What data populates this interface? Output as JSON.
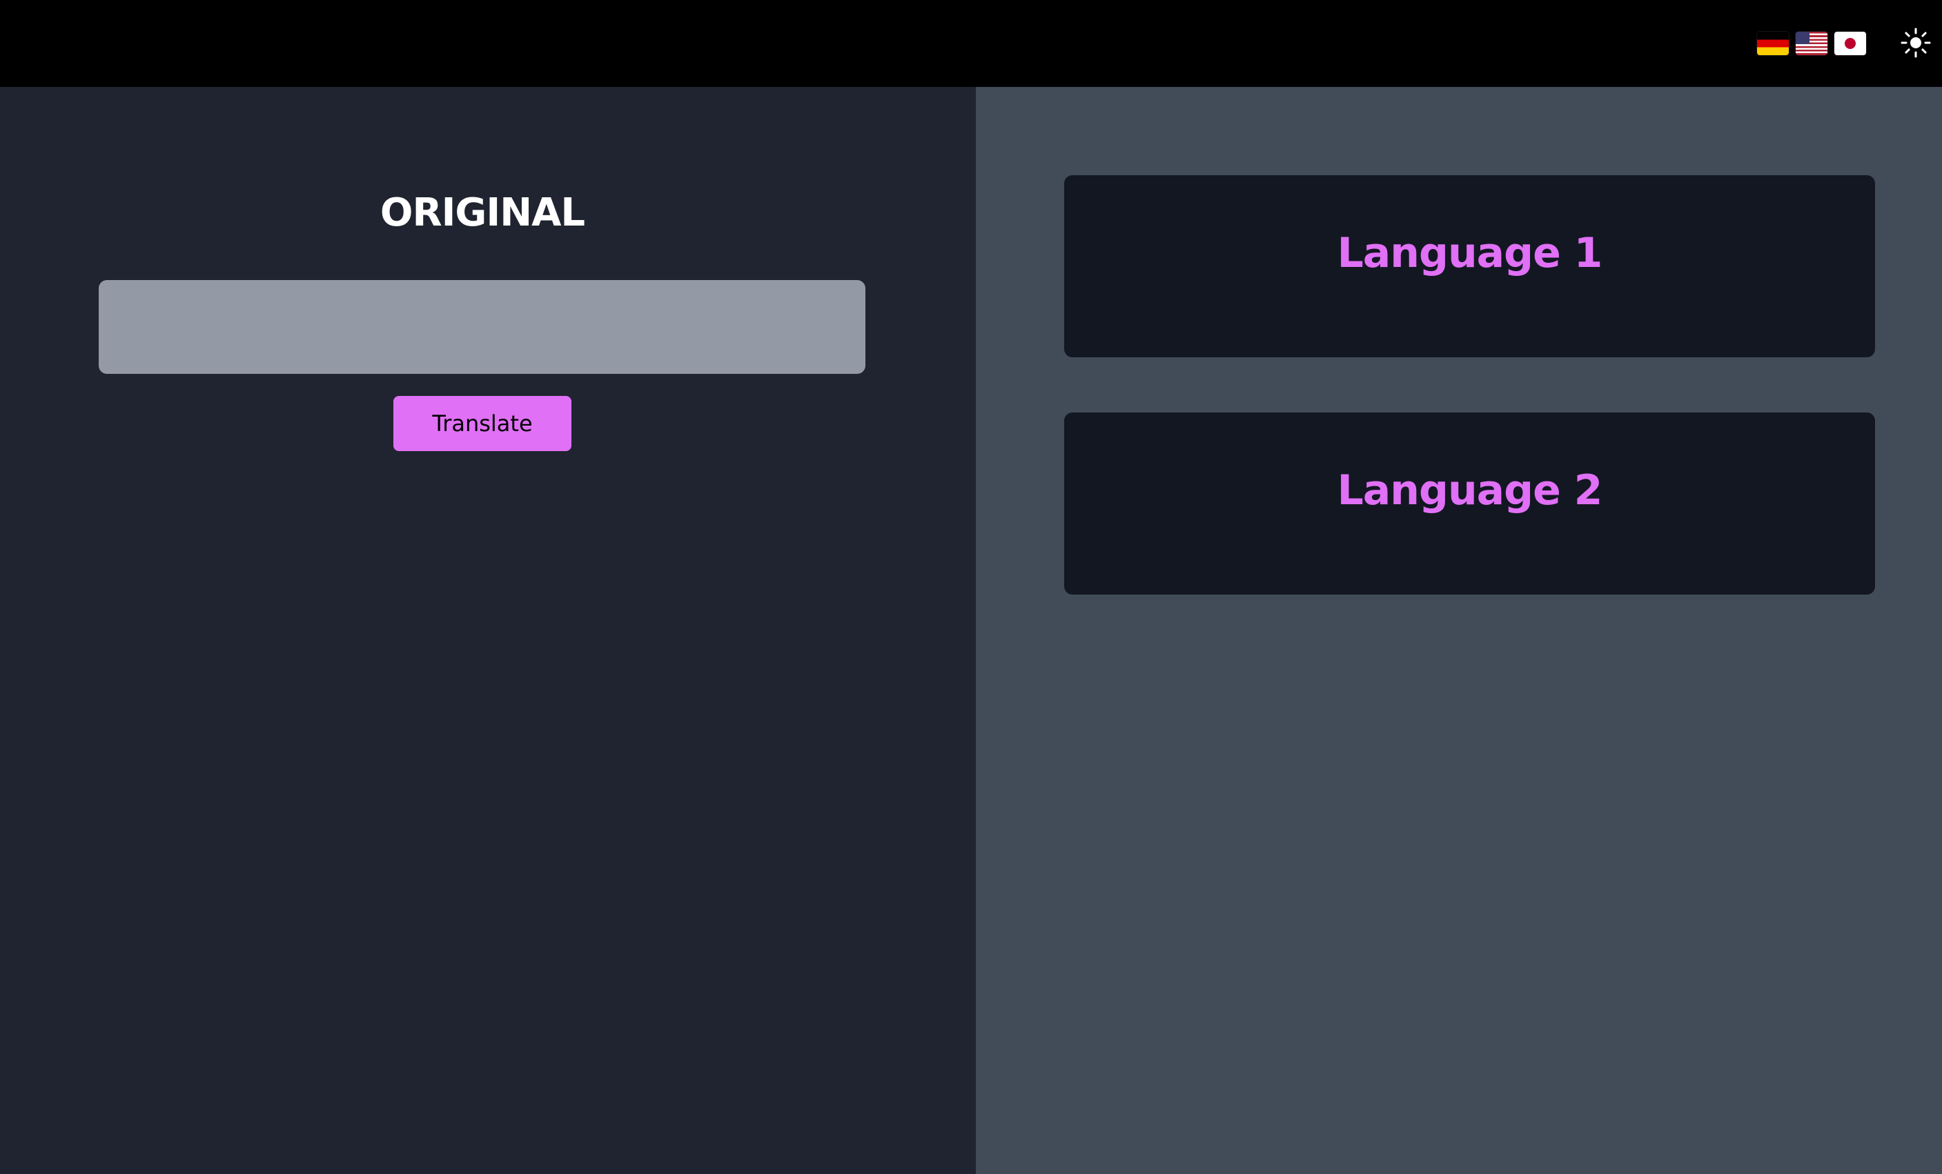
{
  "header": {
    "languages": [
      {
        "name": "German",
        "icon": "flag-de-icon"
      },
      {
        "name": "English (US)",
        "icon": "flag-us-icon"
      },
      {
        "name": "Japanese",
        "icon": "flag-jp-icon"
      }
    ],
    "theme_toggle_icon": "sun-icon"
  },
  "original": {
    "title": "ORIGINAL",
    "input_value": "",
    "input_placeholder": "",
    "translate_label": "Translate"
  },
  "results": {
    "cards": [
      {
        "title": "Language 1"
      },
      {
        "title": "Language 2"
      }
    ]
  },
  "colors": {
    "accent": "#e070f5",
    "left_panel_bg": "#1f2430",
    "right_panel_bg": "#424c59",
    "card_bg": "#131722",
    "topbar_bg": "#000000",
    "input_bg": "#939aa6"
  }
}
